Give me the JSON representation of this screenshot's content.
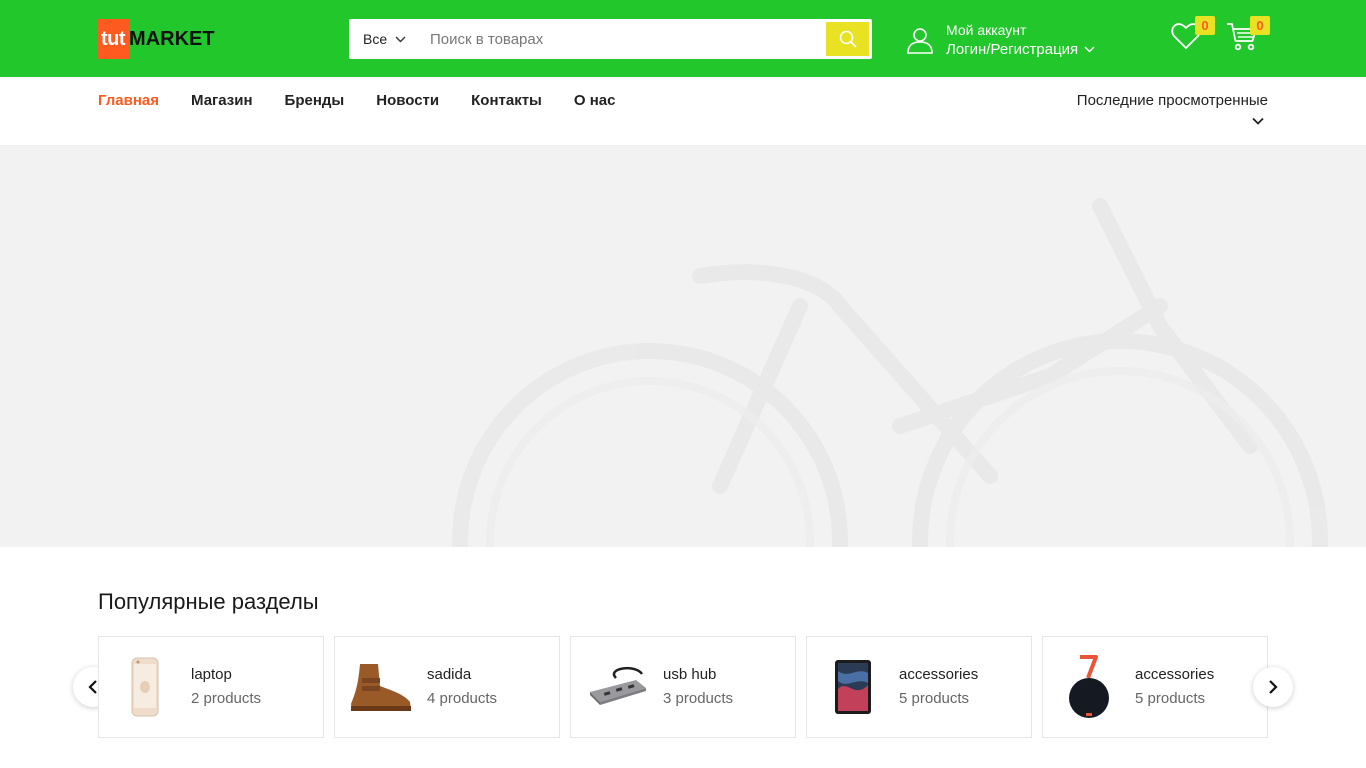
{
  "brand": {
    "logo_part1": "tut",
    "logo_part2": "MARKET",
    "accent": "#22c72c",
    "logo_accent": "#ff5a1f",
    "search_button_color": "#e8e222"
  },
  "search": {
    "category": "Все",
    "placeholder": "Поиск в товарах"
  },
  "account": {
    "title": "Мой аккаунт",
    "login": "Логин/Регистрация"
  },
  "wishlist": {
    "count": "0",
    "icon": "heart-icon"
  },
  "cart": {
    "count": "0",
    "icon": "cart-icon"
  },
  "nav": {
    "items": [
      {
        "label": "Главная",
        "active": true
      },
      {
        "label": "Магазин"
      },
      {
        "label": "Бренды"
      },
      {
        "label": "Новости"
      },
      {
        "label": "Контакты"
      },
      {
        "label": "О нас"
      }
    ],
    "recent": "Последние просмотренные"
  },
  "popular": {
    "title": "Популярные разделы",
    "categories": [
      {
        "name": "laptop",
        "count": "2 products",
        "icon": "phone-image"
      },
      {
        "name": "sadida",
        "count": "4 products",
        "icon": "boot-image"
      },
      {
        "name": "usb hub",
        "count": "3 products",
        "icon": "usb-hub-image"
      },
      {
        "name": "accessories",
        "count": "5 products",
        "icon": "tablet-image"
      },
      {
        "name": "accessories",
        "count": "5 products",
        "icon": "speaker-image"
      }
    ]
  }
}
